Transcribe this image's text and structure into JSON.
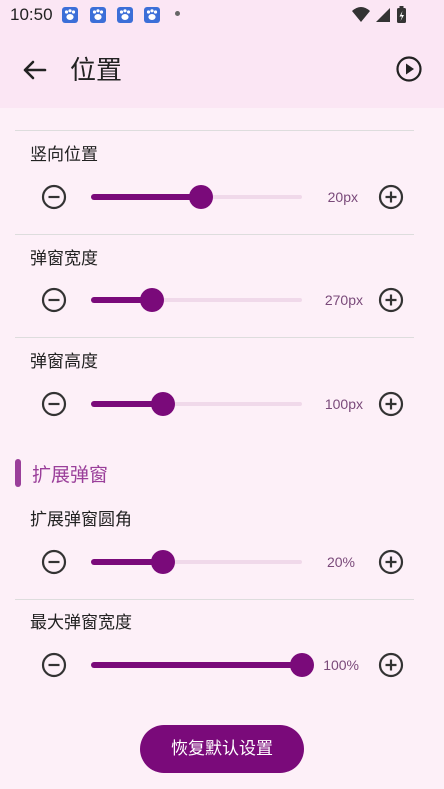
{
  "status_bar": {
    "time": "10:50",
    "notification_icons": [
      "baidu-paw-icon",
      "baidu-paw-icon",
      "baidu-paw-icon",
      "baidu-paw-icon"
    ],
    "system_icons": [
      "wifi-icon",
      "cellular-signal-icon",
      "battery-icon"
    ]
  },
  "app_bar": {
    "title": "位置",
    "back_icon": "arrow-left-icon",
    "action_icon": "play-circle-icon"
  },
  "settings": [
    {
      "label": "竖向位置",
      "value_text": "20px",
      "fraction": 0.52
    },
    {
      "label": "弹窗宽度",
      "value_text": "270px",
      "fraction": 0.29
    },
    {
      "label": "弹窗高度",
      "value_text": "100px",
      "fraction": 0.34
    }
  ],
  "section": {
    "title": "扩展弹窗"
  },
  "extended_settings": [
    {
      "label": "扩展弹窗圆角",
      "value_text": "20%",
      "fraction": 0.34
    },
    {
      "label": "最大弹窗宽度",
      "value_text": "100%",
      "fraction": 1.0
    }
  ],
  "reset_button": {
    "label": "恢复默认设置"
  },
  "colors": {
    "accent": "#7a0a7a",
    "section_accent": "#9a3f9a",
    "track": "#f0d9ea",
    "background": "#fdf0f8",
    "app_bar": "#fbe6f4"
  }
}
